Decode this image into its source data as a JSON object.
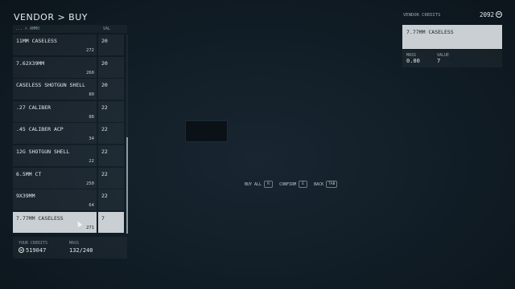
{
  "header": {
    "title": "VENDOR > BUY"
  },
  "list": {
    "col_name": "... > AMMO",
    "col_val": "VAL",
    "items": [
      {
        "name": "11MM CASELESS",
        "qty": "272",
        "val": "20",
        "selected": false
      },
      {
        "name": "7.62X39MM",
        "qty": "260",
        "val": "20",
        "selected": false
      },
      {
        "name": "CASELESS SHOTGUN SHELL",
        "qty": "80",
        "val": "20",
        "selected": false
      },
      {
        "name": ".27 CALIBER",
        "qty": "88",
        "val": "22",
        "selected": false
      },
      {
        "name": ".45 CALIBER ACP",
        "qty": "34",
        "val": "22",
        "selected": false
      },
      {
        "name": "12G SHOTGUN SHELL",
        "qty": "22",
        "val": "22",
        "selected": false
      },
      {
        "name": "6.5MM CT",
        "qty": "250",
        "val": "22",
        "selected": false
      },
      {
        "name": "9X39MM",
        "qty": "64",
        "val": "22",
        "selected": false
      },
      {
        "name": "7.77MM CASELESS",
        "qty": "271",
        "val": "7",
        "selected": true
      }
    ]
  },
  "footer": {
    "credits_label": "YOUR CREDITS",
    "credits_value": "519047",
    "mass_label": "MASS",
    "mass_value": "132/240"
  },
  "actions": [
    {
      "label": "BUY ALL",
      "key": "R"
    },
    {
      "label": "CONFIRM",
      "key": "E"
    },
    {
      "label": "BACK",
      "key": "TAB"
    }
  ],
  "vendor": {
    "credits_label": "VENDOR CREDITS",
    "credits_value": "2092"
  },
  "detail": {
    "name": "7.77MM CASELESS",
    "mass_label": "MASS",
    "mass_value": "0.00",
    "value_label": "VALUE",
    "value_value": "7"
  }
}
